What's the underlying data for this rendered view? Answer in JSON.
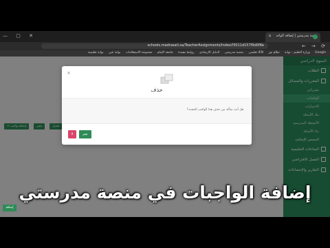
{
  "browser": {
    "tab_title": "منصة مدرستي | إضافة الواجبات",
    "url": "schools.madrasati.sa/TeacherAssignments/Index/f3011d157f9d0f8e",
    "window_controls": "— ▢ ✕",
    "nav_icons": "← → ⟳",
    "bookmarks": [
      "Google",
      "وزارة التعليم - بوابة",
      "نظام نور",
      "iEN تعليمي",
      "منصة مدرستي",
      "الدليل الارشادي",
      "روابط مفيدة",
      "جامعة الإمام",
      "مجموعة الاستعلامات",
      "بوابة عين",
      "بوابة تعليمية"
    ]
  },
  "sidebar": {
    "header": "المنهج الدراسي",
    "items": [
      {
        "label": "الطلاب"
      },
      {
        "label": "المقررات والمسائل"
      },
      {
        "label": "مقرراتي"
      }
    ],
    "subitems": [
      {
        "label": "الواجبات",
        "active": true
      },
      {
        "label": "الاختبارات",
        "active": false
      },
      {
        "label": "بنك الأسئلة",
        "active": false
      },
      {
        "label": "الأنشطة المدرسية",
        "active": false
      },
      {
        "label": "بناء الأسئلة",
        "active": false
      },
      {
        "label": "الحصص الإضافية",
        "active": false
      }
    ],
    "bottom_items": [
      {
        "label": "الساعات التعليمية"
      },
      {
        "label": "الفصل الافتراضي"
      },
      {
        "label": "التقارير والإحصاءات"
      }
    ]
  },
  "toolbar": {
    "buttons": [
      "+ إضافة واجب",
      "نشر",
      "تعديل",
      "حذف"
    ]
  },
  "modal": {
    "title": "حذف",
    "message": "هل أنت متأكد من حذف هذا الواجب المحدد؟",
    "confirm_label": "نعم",
    "cancel_label": "لا"
  },
  "caption": "إضافة الواجبات في منصة مدرستي",
  "corner_button": "إضافة",
  "colors": {
    "primary_green": "#2b8a5c",
    "cancel_pink": "#d9456b"
  }
}
